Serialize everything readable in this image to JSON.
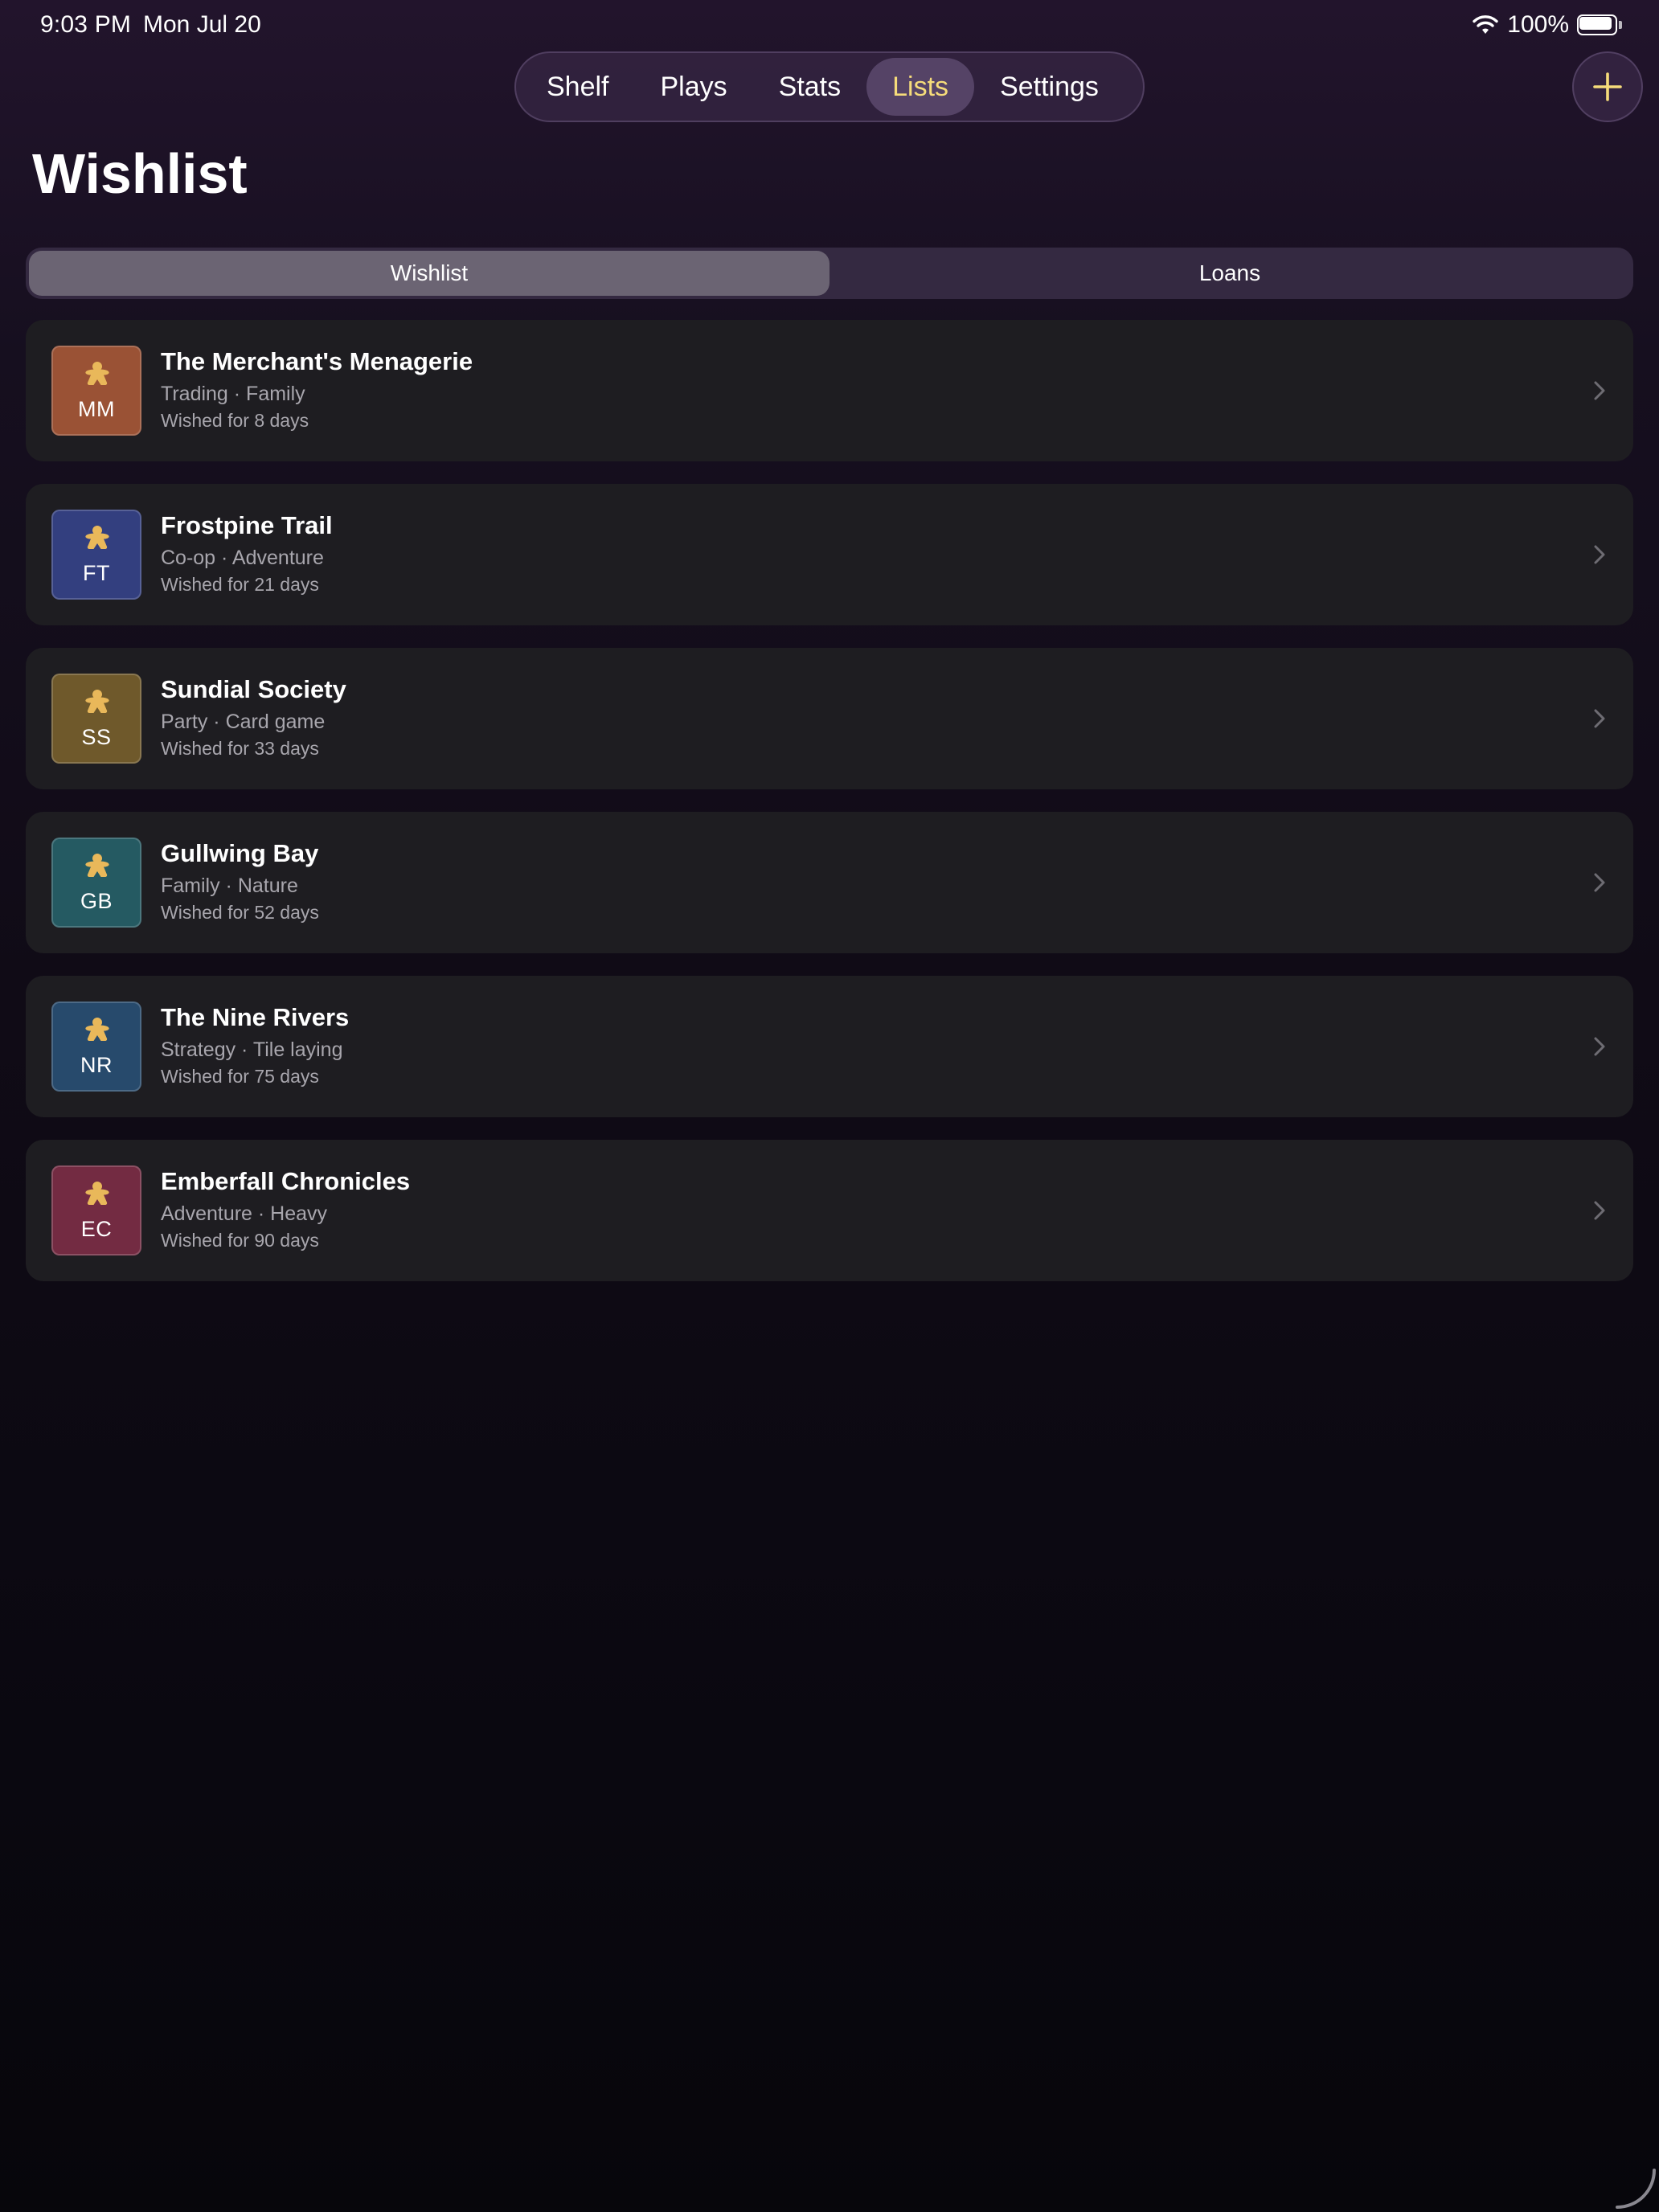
{
  "status": {
    "time": "9:03 PM",
    "date": "Mon Jul 20",
    "battery": "100%"
  },
  "tabs": [
    {
      "label": "Shelf",
      "active": false
    },
    {
      "label": "Plays",
      "active": false
    },
    {
      "label": "Stats",
      "active": false
    },
    {
      "label": "Lists",
      "active": true
    },
    {
      "label": "Settings",
      "active": false
    }
  ],
  "page_title": "Wishlist",
  "segments": [
    {
      "label": "Wishlist",
      "selected": true
    },
    {
      "label": "Loans",
      "selected": false
    }
  ],
  "colors": {
    "accent": "#f6dc7a",
    "meeple": "#e9b85a"
  },
  "items": [
    {
      "initials": "MM",
      "title": "The Merchant's Menagerie",
      "genre": "Trading · Family",
      "wished": "Wished for 8 days",
      "color": "#9a5235"
    },
    {
      "initials": "FT",
      "title": "Frostpine Trail",
      "genre": "Co-op · Adventure",
      "wished": "Wished for 21 days",
      "color": "#333f7f"
    },
    {
      "initials": "SS",
      "title": "Sundial Society",
      "genre": "Party · Card game",
      "wished": "Wished for 33 days",
      "color": "#6f592b"
    },
    {
      "initials": "GB",
      "title": "Gullwing Bay",
      "genre": "Family · Nature",
      "wished": "Wished for 52 days",
      "color": "#255a62"
    },
    {
      "initials": "NR",
      "title": "The Nine Rivers",
      "genre": "Strategy · Tile laying",
      "wished": "Wished for 75 days",
      "color": "#274a6c"
    },
    {
      "initials": "EC",
      "title": "Emberfall Chronicles",
      "genre": "Adventure · Heavy",
      "wished": "Wished for 90 days",
      "color": "#732b42"
    }
  ]
}
